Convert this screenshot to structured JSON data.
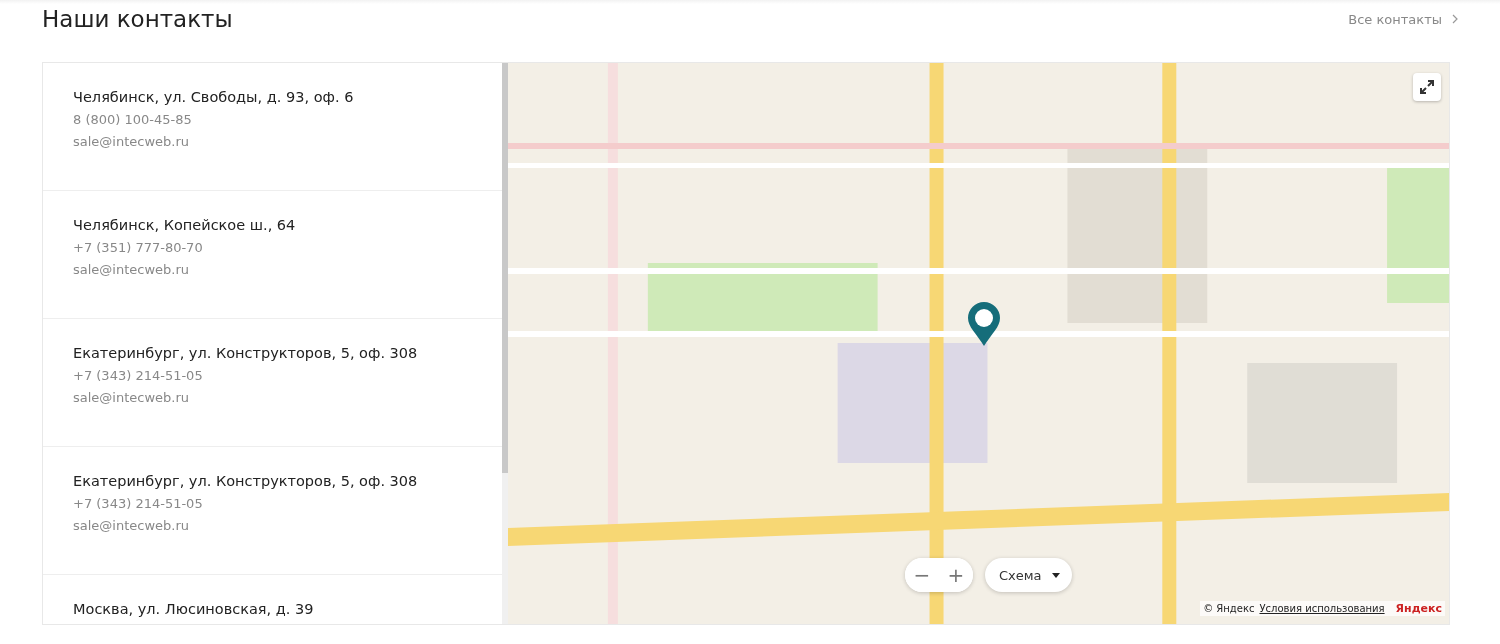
{
  "header": {
    "title": "Наши контакты",
    "link": "Все контакты"
  },
  "contacts": [
    {
      "address": "Челябинск, ул. Свободы, д. 93, оф. 6",
      "phone": "8 (800) 100-45-85",
      "email": "sale@intecweb.ru"
    },
    {
      "address": "Челябинск, Копейское ш., 64",
      "phone": "+7 (351) 777-80-70",
      "email": "sale@intecweb.ru"
    },
    {
      "address": "Екатеринбург, ул. Конструкторов, 5, оф. 308",
      "phone": "+7 (343) 214-51-05",
      "email": "sale@intecweb.ru"
    },
    {
      "address": "Екатеринбург, ул. Конструкторов, 5, оф. 308",
      "phone": "+7 (343) 214-51-05",
      "email": "sale@intecweb.ru"
    },
    {
      "address": "Москва, ул. Люсиновская, д. 39"
    }
  ],
  "map": {
    "kind": "picture",
    "zoom_out": "−",
    "zoom_in": "+",
    "layer": "Схема",
    "copyright": "© Яндекс",
    "terms": "Условия использования",
    "logo": "Яндекс"
  }
}
